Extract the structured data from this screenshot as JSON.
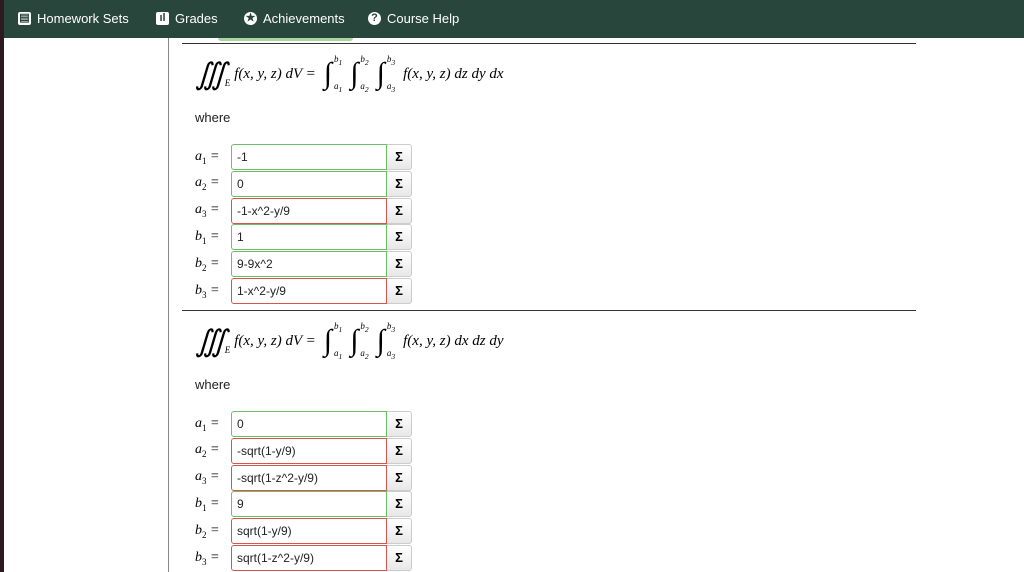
{
  "nav": [
    {
      "label": "Homework Sets",
      "icon": "book-icon",
      "glyph": "▤"
    },
    {
      "label": "Grades",
      "icon": "bar-chart-icon",
      "glyph": "ıl"
    },
    {
      "label": "Achievements",
      "icon": "star-icon",
      "glyph": "★"
    },
    {
      "label": "Course Help",
      "icon": "question-icon",
      "glyph": "?"
    }
  ],
  "sigma": "Σ",
  "sections": [
    {
      "lhs": "f(x, y, z) dV =",
      "rhs": "f(x, y, z) dz dy dx",
      "where": "where",
      "rows": [
        {
          "var": "a",
          "sub": "1",
          "value": "-1",
          "status": "ok"
        },
        {
          "var": "a",
          "sub": "2",
          "value": "0",
          "status": "ok"
        },
        {
          "var": "a",
          "sub": "3",
          "value": "-1-x^2-y/9",
          "status": "bad"
        },
        {
          "var": "b",
          "sub": "1",
          "value": "1",
          "status": "ok"
        },
        {
          "var": "b",
          "sub": "2",
          "value": "9-9x^2",
          "status": "ok"
        },
        {
          "var": "b",
          "sub": "3",
          "value": "1-x^2-y/9",
          "status": "bad"
        }
      ]
    },
    {
      "lhs": "f(x, y, z) dV =",
      "rhs": "f(x, y, z) dx dz dy",
      "where": "where",
      "rows": [
        {
          "var": "a",
          "sub": "1",
          "value": "0",
          "status": "ok"
        },
        {
          "var": "a",
          "sub": "2",
          "value": "-sqrt(1-y/9)",
          "status": "bad"
        },
        {
          "var": "a",
          "sub": "3",
          "value": "-sqrt(1-z^2-y/9)",
          "status": "bad"
        },
        {
          "var": "b",
          "sub": "1",
          "value": "9",
          "status": "ok"
        },
        {
          "var": "b",
          "sub": "2",
          "value": "sqrt(1-y/9)",
          "status": "bad"
        },
        {
          "var": "b",
          "sub": "3",
          "value": "sqrt(1-z^2-y/9)",
          "status": "bad"
        }
      ]
    }
  ]
}
